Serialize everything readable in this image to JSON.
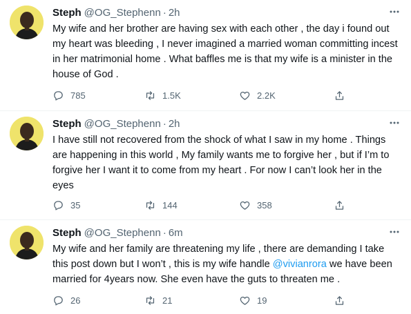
{
  "tweets": [
    {
      "name": "Steph",
      "handle": "@OG_Stephenn",
      "dot": "·",
      "time": "2h",
      "text": "My wife and her brother are having sex with each other , the day i found out my heart was bleeding , I never imagined a married woman committing incest in her matrimonial home .     What baffles me is that my wife is a minister in the house of God .",
      "replies": "785",
      "retweets": "1.5K",
      "likes": "2.2K"
    },
    {
      "name": "Steph",
      "handle": "@OG_Stephenn",
      "dot": "·",
      "time": "2h",
      "text": "I have still not recovered from the shock of what I saw in my home .  Things are happening in this world ,  My family wants me to forgive her , but if I’m to forgive her I want it to come from my heart . For now I can’t look her in the eyes",
      "replies": "35",
      "retweets": "144",
      "likes": "358"
    },
    {
      "name": "Steph",
      "handle": "@OG_Stephenn",
      "dot": "·",
      "time": "6m",
      "text_before": "My wife and her family are threatening my life , there are demanding I take this post down but I won’t , this is my wife handle ",
      "mention": "@vivianrora",
      "text_after": " we have been married for 4years now. She even have the guts to threaten me .",
      "replies": "26",
      "retweets": "21",
      "likes": "19"
    }
  ],
  "icons": {
    "reply": "reply-icon",
    "retweet": "retweet-icon",
    "like": "heart-icon",
    "share": "share-icon",
    "more": "more-icon"
  },
  "colors": {
    "text": "#0f1419",
    "secondary": "#536471",
    "mention": "#1d9bf0",
    "separator": "#eff3f4"
  }
}
